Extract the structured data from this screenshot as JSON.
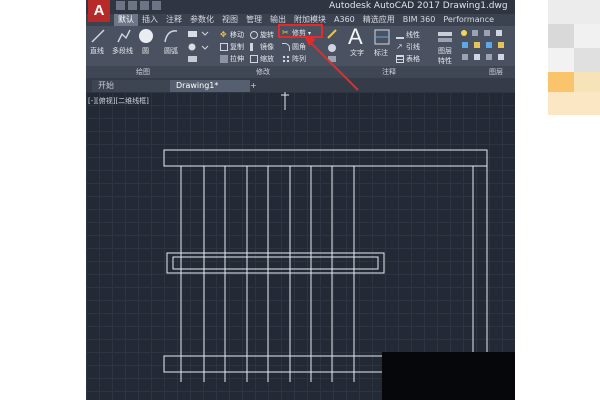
{
  "app": {
    "logo_text": "A",
    "title": "Autodesk AutoCAD 2017    Drawing1.dwg"
  },
  "ribbon_tabs": [
    "默认",
    "插入",
    "注释",
    "参数化",
    "视图",
    "管理",
    "输出",
    "附加模块",
    "A360",
    "精选应用",
    "BIM 360",
    "Performance"
  ],
  "ribbon": {
    "draw_tools": [
      "直线",
      "多段线",
      "圆",
      "圆弧"
    ],
    "modify_tools": [
      "移动",
      "旋转",
      "修剪",
      "复制",
      "镜像",
      "圆角",
      "拉伸",
      "缩放",
      "阵列"
    ],
    "annotation_tools": [
      "文字",
      "标注",
      "线性",
      "引线",
      "表格"
    ],
    "layer_tools": [
      "图层",
      "特性"
    ],
    "panel_labels": [
      "绘图",
      "修改",
      "注释",
      "图层"
    ]
  },
  "doc_tabs": [
    "开始",
    "Drawing1*"
  ],
  "doc_tab_add": "+",
  "canvas": {
    "viewport_label": "[-][俯视][二维线框]"
  },
  "colors": {
    "highlight": "#e22b2b",
    "arrow": "#e22b2b",
    "canvas_bg": "#232a35",
    "lines": "#e8eaee"
  }
}
